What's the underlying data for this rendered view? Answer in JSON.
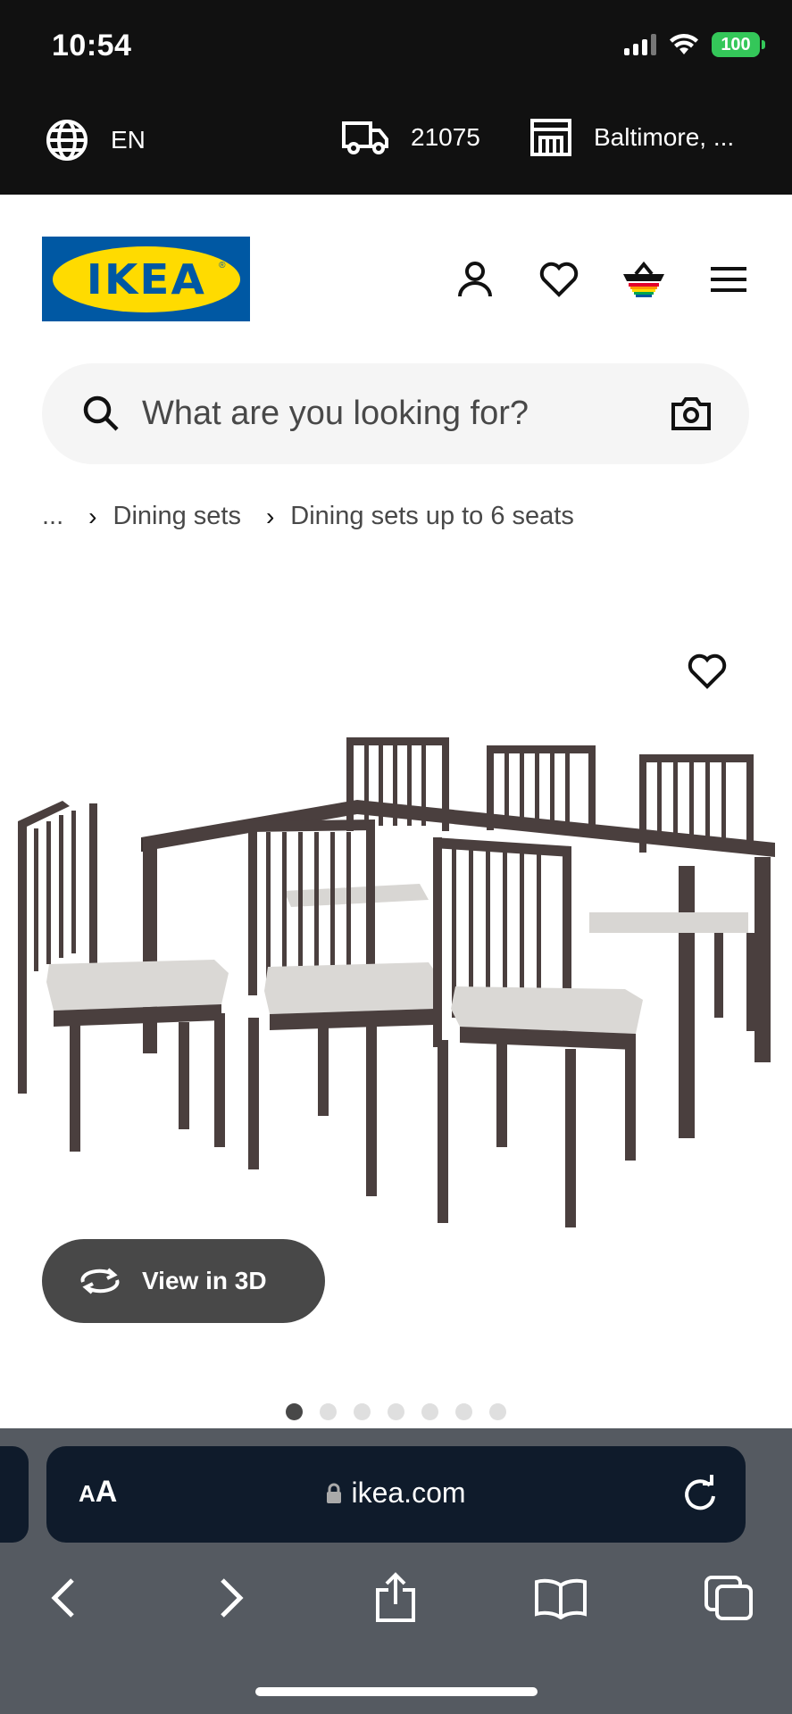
{
  "status_bar": {
    "time": "10:54",
    "battery": "100",
    "icons": [
      "cellular-signal-icon",
      "wifi-icon",
      "battery-icon"
    ]
  },
  "utility_bar": {
    "language": "EN",
    "zip": "21075",
    "store": "Baltimore, ...",
    "icons": [
      "globe-icon",
      "truck-icon",
      "store-icon"
    ]
  },
  "header": {
    "logo_text": "IKEA",
    "icons": [
      "user-icon",
      "heart-icon",
      "basket-icon",
      "menu-icon"
    ]
  },
  "search": {
    "placeholder": "What are you looking for?",
    "icons": [
      "search-icon",
      "camera-icon"
    ]
  },
  "breadcrumb": {
    "ellipsis": "...",
    "items": [
      "Dining sets",
      "Dining sets up to 6 seats"
    ]
  },
  "product_gallery": {
    "view_3d_label": "View in 3D",
    "slide_count": 7,
    "active_slide": 1
  },
  "browser": {
    "text_size_label": "AA",
    "url": "ikea.com",
    "icons": [
      "lock-icon",
      "reload-icon",
      "back-icon",
      "forward-icon",
      "share-icon",
      "bookmarks-icon",
      "tabs-icon"
    ]
  },
  "colors": {
    "ikea_blue": "#0058a3",
    "ikea_yellow": "#ffdb00",
    "dark_bar": "#111111",
    "button_gray": "#484848",
    "browser_bg": "#555a61"
  }
}
